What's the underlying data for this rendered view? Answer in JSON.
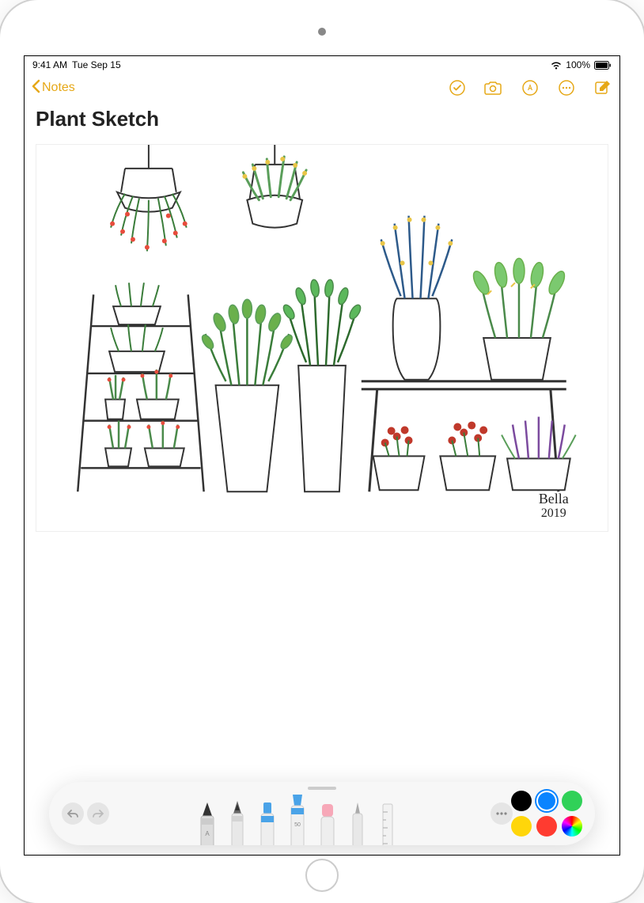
{
  "status": {
    "time": "9:41 AM",
    "date": "Tue Sep 15",
    "battery_percent": "100%"
  },
  "nav": {
    "back_label": "Notes"
  },
  "note": {
    "title": "Plant Sketch",
    "signature_name": "Bella",
    "signature_year": "2019"
  },
  "markup": {
    "colors": {
      "black": "#000000",
      "blue": "#0a84ff",
      "green": "#30d158",
      "yellow": "#ffd60a",
      "red": "#ff3b30"
    },
    "selected_color": "blue"
  }
}
